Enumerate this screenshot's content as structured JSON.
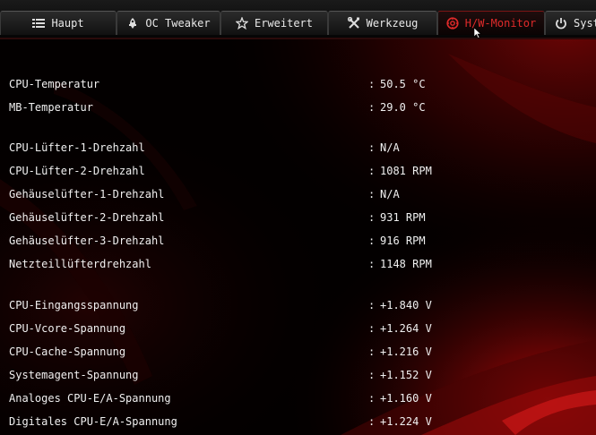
{
  "tabs": [
    {
      "label": "Haupt",
      "icon": "list-icon"
    },
    {
      "label": "OC Tweaker",
      "icon": "rocket-icon"
    },
    {
      "label": "Erweitert",
      "icon": "star-icon"
    },
    {
      "label": "Werkzeug",
      "icon": "tools-icon"
    },
    {
      "label": "H/W-Monitor",
      "icon": "monitor-gauge-icon",
      "active": true
    },
    {
      "label": "Syst",
      "icon": "power-icon"
    }
  ],
  "separator": ":",
  "rows": [
    {
      "label": "CPU-Temperatur",
      "value": "50.5 °C"
    },
    {
      "label": "MB-Temperatur",
      "value": "29.0 °C"
    },
    {
      "label": "CPU-Lüfter-1-Drehzahl",
      "value": "N/A"
    },
    {
      "label": "CPU-Lüfter-2-Drehzahl",
      "value": "1081 RPM"
    },
    {
      "label": "Gehäuselüfter-1-Drehzahl",
      "value": "N/A"
    },
    {
      "label": "Gehäuselüfter-2-Drehzahl",
      "value": "931 RPM"
    },
    {
      "label": "Gehäuselüfter-3-Drehzahl",
      "value": "916 RPM"
    },
    {
      "label": "Netzteillüfterdrehzahl",
      "value": "1148 RPM"
    },
    {
      "label": "CPU-Eingangsspannung",
      "value": "+1.840 V"
    },
    {
      "label": "CPU-Vcore-Spannung",
      "value": "+1.264 V"
    },
    {
      "label": "CPU-Cache-Spannung",
      "value": "+1.216 V"
    },
    {
      "label": "Systemagent-Spannung",
      "value": "+1.152 V"
    },
    {
      "label": "Analoges CPU-E/A-Spannung",
      "value": "+1.160 V"
    },
    {
      "label": "Digitales CPU-E/A-Spannung",
      "value": "+1.224 V"
    }
  ],
  "colors": {
    "accent": "#e02a2a",
    "text": "#f0f0f0",
    "background": "#000000"
  }
}
